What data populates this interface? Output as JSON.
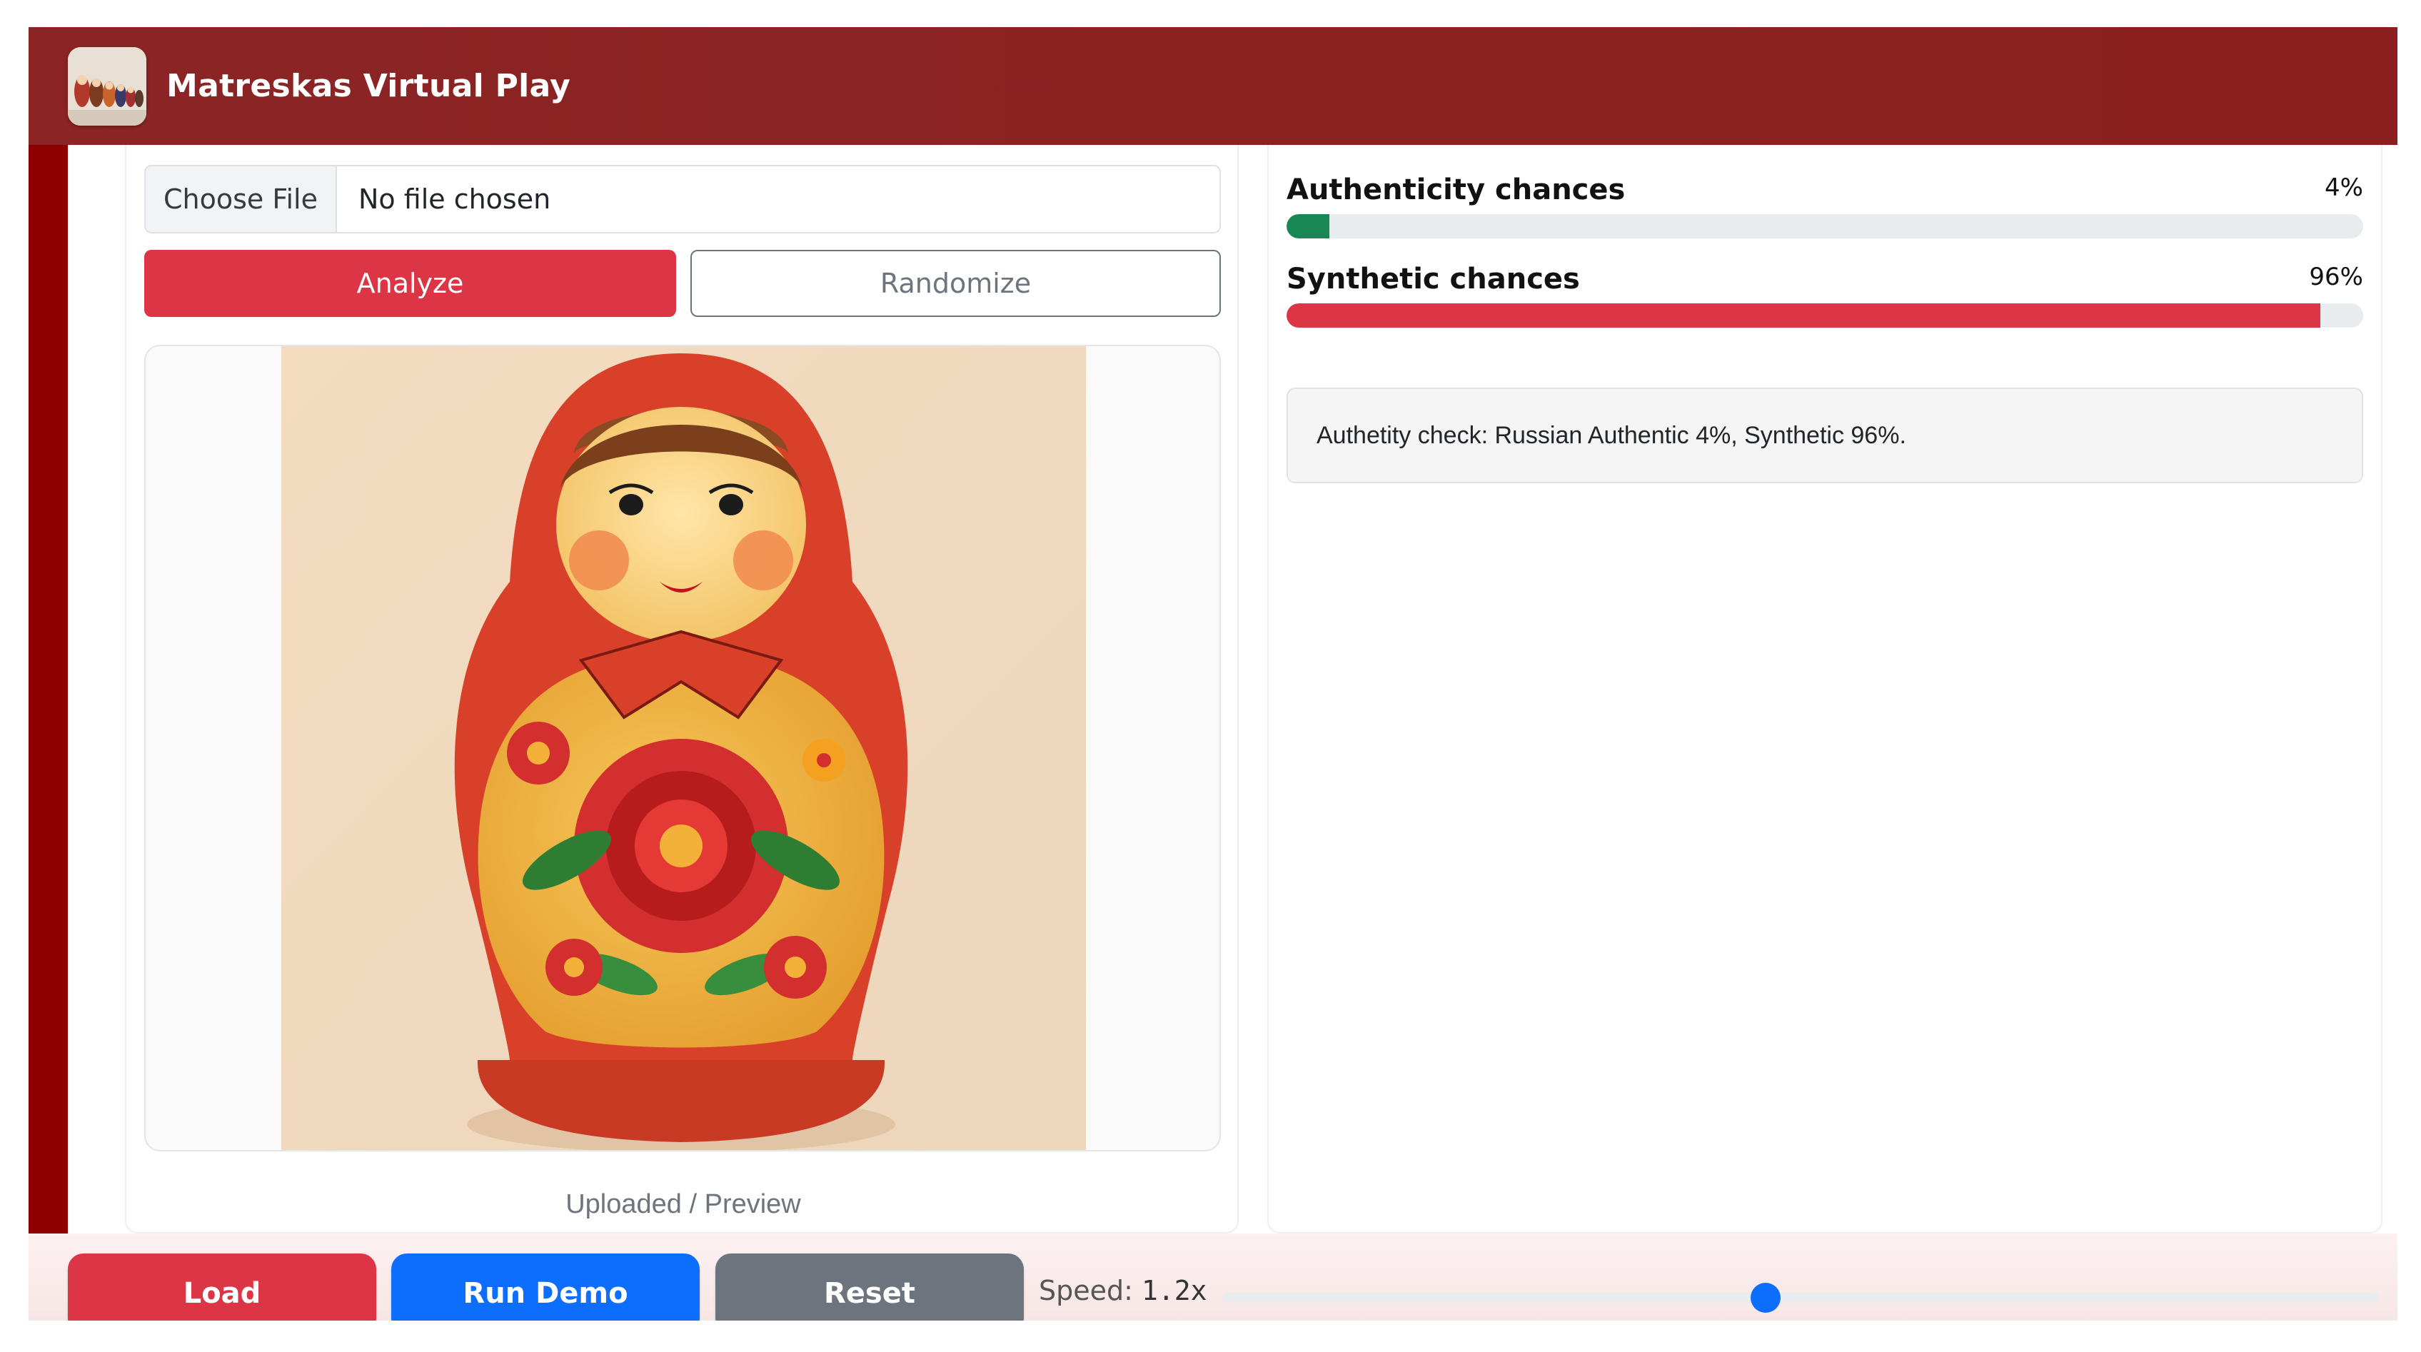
{
  "app": {
    "title": "Matreskas Virtual Play"
  },
  "upload": {
    "choose_file_label": "Choose File",
    "file_status": "No file chosen",
    "analyze_label": "Analyze",
    "randomize_label": "Randomize",
    "preview_caption": "Uploaded / Preview"
  },
  "results": {
    "authenticity": {
      "label": "Authenticity chances",
      "value_text": "4%",
      "value": 0.04,
      "color": "#198754"
    },
    "synthetic": {
      "label": "Synthetic chances",
      "value_text": "96%",
      "value": 0.96,
      "color": "#dc3545"
    },
    "summary": "Authetity check: Russian Authentic 4%, Synthetic 96%."
  },
  "footer": {
    "load_label": "Load",
    "run_demo_label": "Run Demo",
    "reset_label": "Reset",
    "speed_label": "Speed:",
    "speed_value": "1.2x",
    "speed_fraction": 0.47
  },
  "colors": {
    "header": "#8b2424",
    "frame": "#8e0000",
    "danger": "#dc3545",
    "primary": "#0d6efd",
    "secondary": "#6c757d",
    "success": "#198754"
  },
  "icons": {
    "logo": "nesting-dolls-logo-icon"
  }
}
